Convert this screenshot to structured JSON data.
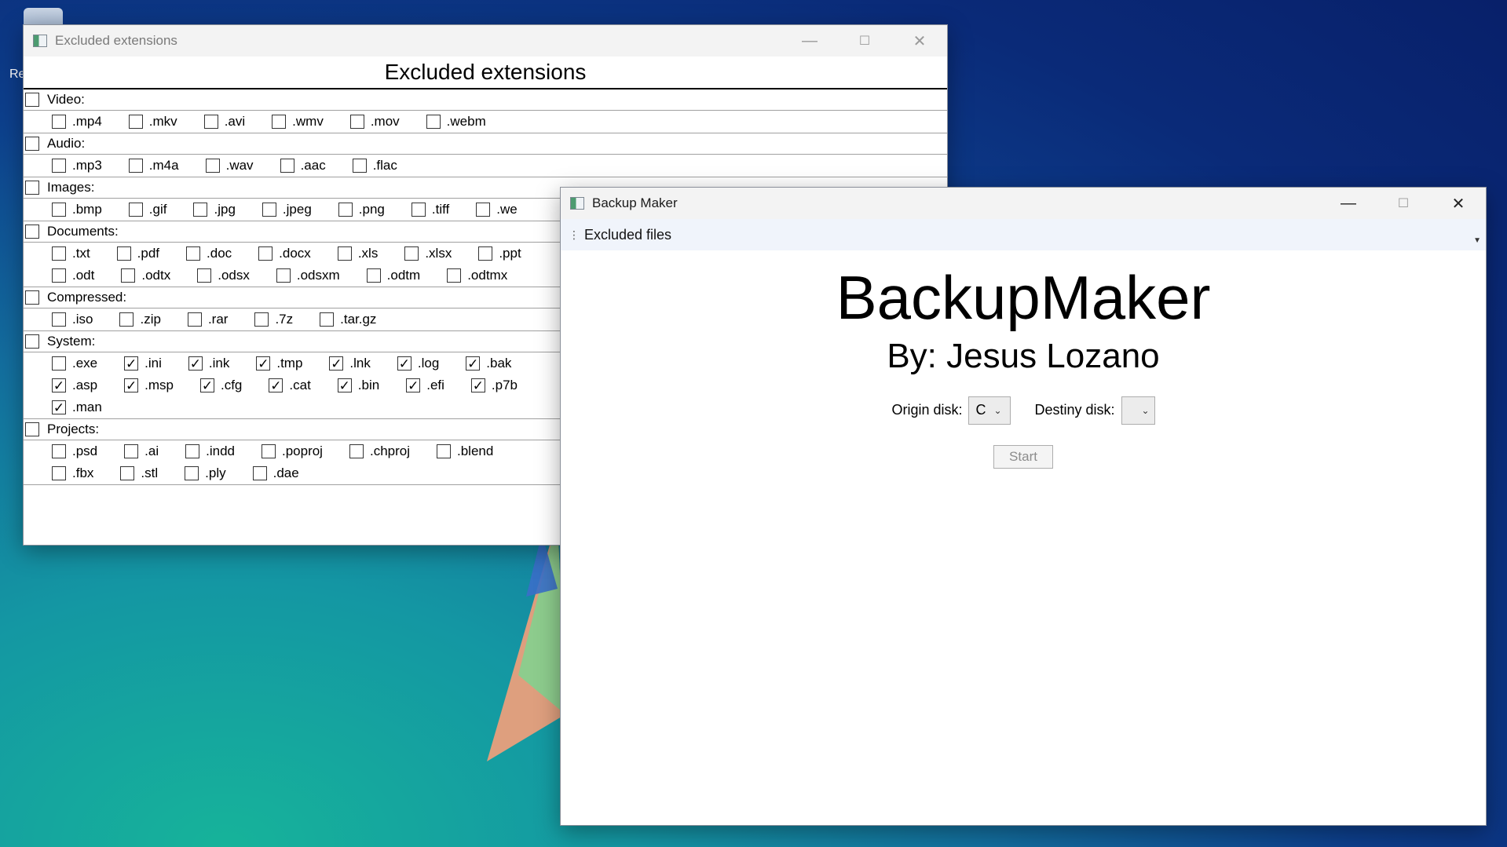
{
  "desktop": {
    "partial_icon_label": "Re"
  },
  "ext_window": {
    "title": "Excluded extensions",
    "heading": "Excluded extensions",
    "categories": [
      {
        "label": "Video:",
        "checked": false,
        "rows": [
          [
            {
              "ext": ".mp4",
              "checked": false
            },
            {
              "ext": ".mkv",
              "checked": false
            },
            {
              "ext": ".avi",
              "checked": false
            },
            {
              "ext": ".wmv",
              "checked": false
            },
            {
              "ext": ".mov",
              "checked": false
            },
            {
              "ext": ".webm",
              "checked": false
            }
          ]
        ]
      },
      {
        "label": "Audio:",
        "checked": false,
        "rows": [
          [
            {
              "ext": ".mp3",
              "checked": false
            },
            {
              "ext": ".m4a",
              "checked": false
            },
            {
              "ext": ".wav",
              "checked": false
            },
            {
              "ext": ".aac",
              "checked": false
            },
            {
              "ext": ".flac",
              "checked": false
            }
          ]
        ]
      },
      {
        "label": "Images:",
        "checked": false,
        "rows": [
          [
            {
              "ext": ".bmp",
              "checked": false
            },
            {
              "ext": ".gif",
              "checked": false
            },
            {
              "ext": ".jpg",
              "checked": false
            },
            {
              "ext": ".jpeg",
              "checked": false
            },
            {
              "ext": ".png",
              "checked": false
            },
            {
              "ext": ".tiff",
              "checked": false
            },
            {
              "ext": ".we",
              "checked": false
            }
          ]
        ]
      },
      {
        "label": "Documents:",
        "checked": false,
        "rows": [
          [
            {
              "ext": ".txt",
              "checked": false
            },
            {
              "ext": ".pdf",
              "checked": false
            },
            {
              "ext": ".doc",
              "checked": false
            },
            {
              "ext": ".docx",
              "checked": false
            },
            {
              "ext": ".xls",
              "checked": false
            },
            {
              "ext": ".xlsx",
              "checked": false
            },
            {
              "ext": ".ppt",
              "checked": false
            }
          ],
          [
            {
              "ext": ".odt",
              "checked": false
            },
            {
              "ext": ".odtx",
              "checked": false
            },
            {
              "ext": ".odsx",
              "checked": false
            },
            {
              "ext": ".odsxm",
              "checked": false
            },
            {
              "ext": ".odtm",
              "checked": false
            },
            {
              "ext": ".odtmx",
              "checked": false
            }
          ]
        ]
      },
      {
        "label": "Compressed:",
        "checked": false,
        "rows": [
          [
            {
              "ext": ".iso",
              "checked": false
            },
            {
              "ext": ".zip",
              "checked": false
            },
            {
              "ext": ".rar",
              "checked": false
            },
            {
              "ext": ".7z",
              "checked": false
            },
            {
              "ext": ".tar.gz",
              "checked": false
            }
          ]
        ]
      },
      {
        "label": "System:",
        "checked": false,
        "rows": [
          [
            {
              "ext": ".exe",
              "checked": false
            },
            {
              "ext": ".ini",
              "checked": true
            },
            {
              "ext": ".ink",
              "checked": true
            },
            {
              "ext": ".tmp",
              "checked": true
            },
            {
              "ext": ".lnk",
              "checked": true
            },
            {
              "ext": ".log",
              "checked": true
            },
            {
              "ext": ".bak",
              "checked": true
            }
          ],
          [
            {
              "ext": ".asp",
              "checked": true
            },
            {
              "ext": ".msp",
              "checked": true
            },
            {
              "ext": ".cfg",
              "checked": true
            },
            {
              "ext": ".cat",
              "checked": true
            },
            {
              "ext": ".bin",
              "checked": true
            },
            {
              "ext": ".efi",
              "checked": true
            },
            {
              "ext": ".p7b",
              "checked": true
            }
          ],
          [
            {
              "ext": ".man",
              "checked": true
            }
          ]
        ]
      },
      {
        "label": "Projects:",
        "checked": false,
        "rows": [
          [
            {
              "ext": ".psd",
              "checked": false
            },
            {
              "ext": ".ai",
              "checked": false
            },
            {
              "ext": ".indd",
              "checked": false
            },
            {
              "ext": ".poproj",
              "checked": false
            },
            {
              "ext": ".chproj",
              "checked": false
            },
            {
              "ext": ".blend",
              "checked": false
            }
          ],
          [
            {
              "ext": ".fbx",
              "checked": false
            },
            {
              "ext": ".stl",
              "checked": false
            },
            {
              "ext": ".ply",
              "checked": false
            },
            {
              "ext": ".dae",
              "checked": false
            }
          ]
        ]
      }
    ]
  },
  "bm_window": {
    "title": "Backup Maker",
    "menu": {
      "excluded_files": "Excluded files"
    },
    "app_title": "BackupMaker",
    "author": "By: Jesus Lozano",
    "origin": {
      "label": "Origin disk:",
      "value": "C"
    },
    "destiny": {
      "label": "Destiny disk:",
      "value": ""
    },
    "start_label": "Start"
  }
}
